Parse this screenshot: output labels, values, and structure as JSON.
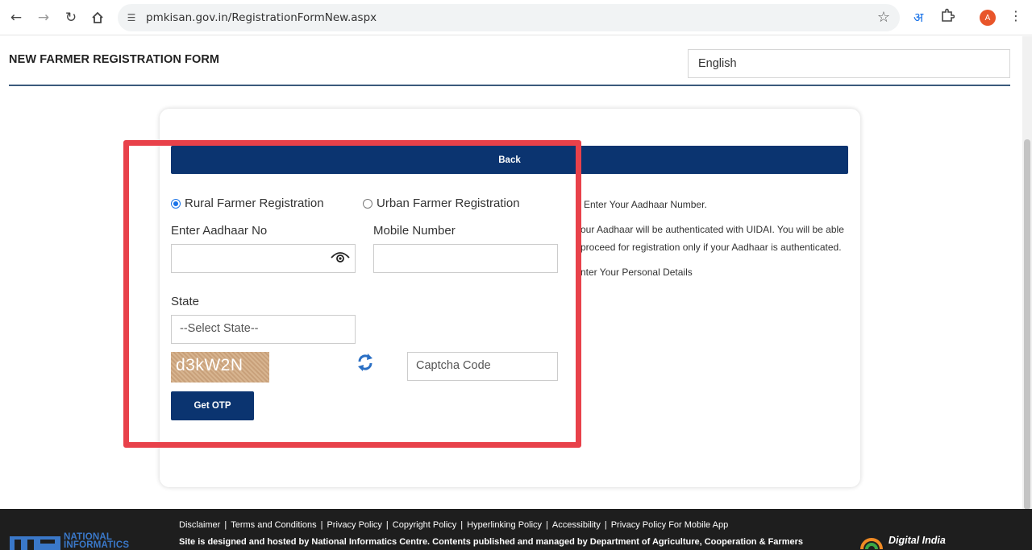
{
  "browser": {
    "url": "pmkisan.gov.in/RegistrationFormNew.aspx",
    "avatar_initial": "A",
    "translate_glyph": "अ"
  },
  "header": {
    "title": "NEW FARMER REGISTRATION FORM",
    "language": "English"
  },
  "form": {
    "back_label": "Back",
    "radio_rural": "Rural Farmer Registration",
    "radio_urban": "Urban Farmer Registration",
    "selected_option": "Rural Farmer Registration",
    "aadhaar_label": "Enter Aadhaar No",
    "aadhaar_value": "",
    "mobile_label": "Mobile Number",
    "mobile_value": "",
    "state_label": "State",
    "state_selected": "--Select State--",
    "captcha_text": "d3kW2N",
    "captcha_placeholder": "Captcha Code",
    "get_otp_label": "Get OTP"
  },
  "info": {
    "line1": "Enter Your Aadhaar Number.",
    "line2": "our Aadhaar will be authenticated with UIDAI. You will be able",
    "line3": "proceed for registration only if your Aadhaar is authenticated.",
    "line4": "nter Your Personal Details"
  },
  "footer": {
    "links": [
      "Disclaimer",
      "Terms and Conditions",
      "Privacy Policy",
      "Copyright Policy",
      "Hyperlinking Policy",
      "Accessibility",
      "Privacy Policy For Mobile App"
    ],
    "text": "Site is designed and hosted by National Informatics Centre. Contents published and managed by Department of Agriculture, Cooperation & Farmers",
    "nic_line1": "NATIONAL",
    "nic_line2": "INFORMATICS",
    "digital_india": "Digital India"
  },
  "colors": {
    "primary_blue": "#0b3470",
    "highlight_red": "#e8414a",
    "footer_bg": "#1e1e1e"
  }
}
